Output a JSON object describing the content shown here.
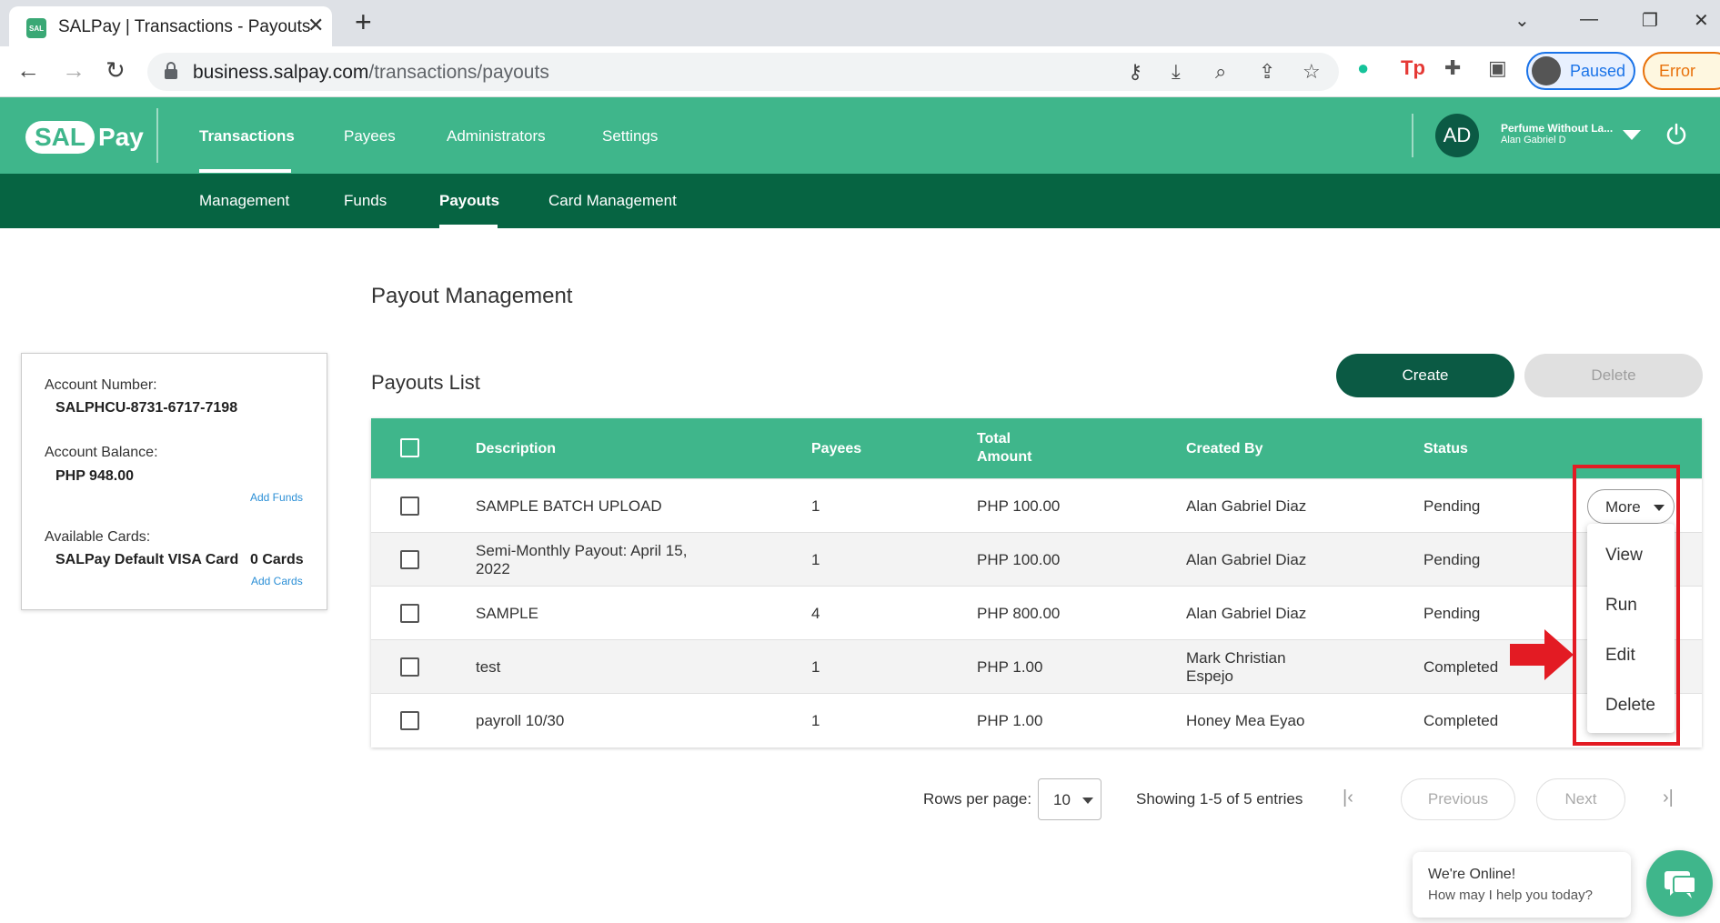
{
  "browser": {
    "tab_title": "SALPay | Transactions - Payouts",
    "favicon_text": "SAL",
    "url_host": "business.salpay.com",
    "url_path": "/transactions/payouts",
    "profile_label": "Paused",
    "error_label": "Error"
  },
  "header": {
    "logo_sal": "SAL",
    "logo_pay": "Pay",
    "main_nav": [
      "Transactions",
      "Payees",
      "Administrators",
      "Settings"
    ],
    "active_main": "Transactions",
    "sub_nav": [
      "Management",
      "Funds",
      "Payouts",
      "Card Management"
    ],
    "active_sub": "Payouts",
    "user_initials": "AD",
    "user_org": "Perfume Without La...",
    "user_name": "Alan Gabriel D"
  },
  "page": {
    "title": "Payout Management",
    "list_title": "Payouts List",
    "create_label": "Create",
    "delete_label": "Delete"
  },
  "account": {
    "number_label": "Account Number:",
    "number": "SALPHCU-8731-6717-7198",
    "balance_label": "Account Balance:",
    "balance": "PHP 948.00",
    "add_funds": "Add Funds",
    "cards_label": "Available Cards:",
    "card_name": "SALPay Default VISA Card",
    "card_count": "0 Cards",
    "add_cards": "Add Cards"
  },
  "table": {
    "headers": {
      "description": "Description",
      "payees": "Payees",
      "total_1": "Total",
      "total_2": "Amount",
      "created_by": "Created By",
      "status": "Status"
    },
    "rows": [
      {
        "desc1": "SAMPLE BATCH UPLOAD",
        "desc2": "",
        "payees": "1",
        "amount": "PHP 100.00",
        "by1": "Alan Gabriel Diaz",
        "by2": "",
        "status": "Pending"
      },
      {
        "desc1": "Semi-Monthly Payout: April 15,",
        "desc2": "2022",
        "payees": "1",
        "amount": "PHP 100.00",
        "by1": "Alan Gabriel Diaz",
        "by2": "",
        "status": "Pending"
      },
      {
        "desc1": "SAMPLE",
        "desc2": "",
        "payees": "4",
        "amount": "PHP 800.00",
        "by1": "Alan Gabriel Diaz",
        "by2": "",
        "status": "Pending"
      },
      {
        "desc1": "test",
        "desc2": "",
        "payees": "1",
        "amount": "PHP 1.00",
        "by1": "Mark Christian",
        "by2": "Espejo",
        "status": "Completed"
      },
      {
        "desc1": "payroll 10/30",
        "desc2": "",
        "payees": "1",
        "amount": "PHP 1.00",
        "by1": "Honey Mea Eyao",
        "by2": "",
        "status": "Completed"
      }
    ],
    "more_label": "More",
    "menu": [
      "View",
      "Run",
      "Edit",
      "Delete"
    ]
  },
  "pagination": {
    "rows_label": "Rows per page:",
    "rows_value": "10",
    "showing": "Showing 1-5 of 5 entries",
    "previous": "Previous",
    "next": "Next"
  },
  "chat": {
    "line1": "We're Online!",
    "line2": "How may I help you today?"
  },
  "colors": {
    "brand": "#3fb68b",
    "brand_dark": "#066442",
    "highlight": "#e31b23"
  }
}
